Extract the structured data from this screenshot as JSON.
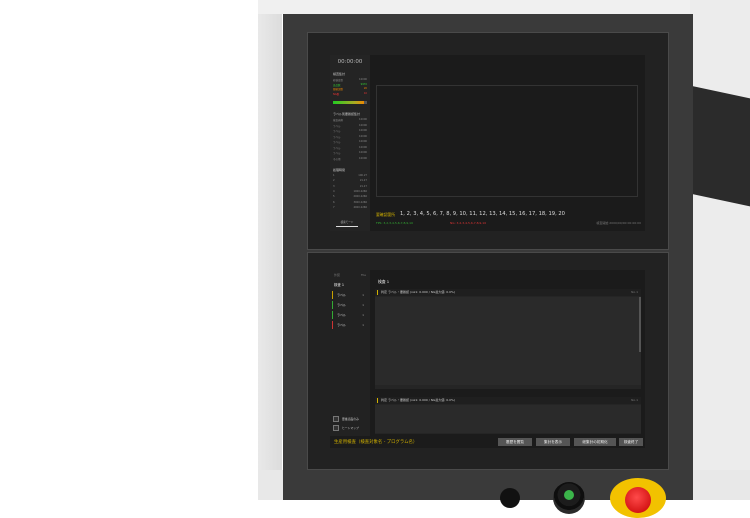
{
  "top_screen": {
    "timer": "00:00:00",
    "left_panel": {
      "section1_title": "検査集計",
      "section1_rows": [
        {
          "label": "総検査数",
          "value": "10000",
          "tone": "gray"
        },
        {
          "label": "良品数",
          "value": "9970",
          "tone": "green"
        },
        {
          "label": "要確認数",
          "value": "20",
          "tone": "orange"
        },
        {
          "label": "NG数",
          "value": "10",
          "tone": "red"
        }
      ],
      "progress": 0.9,
      "section2_title": "ラベル別要確認集計",
      "section2_rows": [
        {
          "label": "検査画像",
          "value": "10000"
        },
        {
          "label": "ラベル",
          "value": "10000"
        },
        {
          "label": "ラベル",
          "value": "10000"
        },
        {
          "label": "ラベル",
          "value": "10000"
        },
        {
          "label": "ラベル",
          "value": "10000"
        },
        {
          "label": "ラベル",
          "value": "10000"
        },
        {
          "label": "ラベル",
          "value": "10000"
        },
        {
          "label": "その他",
          "value": "10000"
        }
      ],
      "section3_title": "処理時間",
      "section3_rows": [
        {
          "label": "1",
          "value": "100.27"
        },
        {
          "label": "2",
          "value": "21.27"
        },
        {
          "label": "3",
          "value": "21.27"
        },
        {
          "label": "4",
          "value": "1000.2266"
        },
        {
          "label": "5",
          "value": "2000.2266"
        },
        {
          "label": "6",
          "value": "3000.2266"
        },
        {
          "label": "7",
          "value": "4000.2266"
        }
      ],
      "monitor_button": "検査モード"
    },
    "summary_label": "要確認箇所",
    "summary_numbers": "1, 2, 3, 4, 5, 6, 7, 8, 9, 10, 11, 12, 13, 14, 15, 16, 17, 18, 19, 20",
    "sub_green": "FPS: 3,2,3,4,5,6,7,8,9,10",
    "sub_red": "NG: 3,2,3,4,5,6,7,8,9,10",
    "timestamp": "検査開始 2000/00/00 00:00:00"
  },
  "bottom_screen": {
    "left_header_left": "外装",
    "left_header_right": "File",
    "item_title": "検査 1",
    "label_list": [
      {
        "label": "ラベル",
        "count": "1",
        "color": "#c8a000"
      },
      {
        "label": "ラベル",
        "count": "1",
        "color": "#33aa33"
      },
      {
        "label": "ラベル",
        "count": "1",
        "color": "#33aa33"
      },
      {
        "label": "ラベル",
        "count": "1",
        "color": "#cc3333"
      }
    ],
    "checkbox1": "要確認品のみ",
    "checkbox2": "ヒートマップ",
    "main_title": "検査 1",
    "panel1_header": "判定  ラベル・要確認 (x≥1: 0.000 / NG最大値: 0.0%)",
    "panel1_right": "No.1",
    "panel2_header": "判定  ラベル・要確認 (x≥1: 0.000 / NG最大値: 0.0%)",
    "panel2_right": "No.1",
    "status_text": "生産用検査（検査対象名 - プログラム名）",
    "buttons": [
      "履歴を閲覧",
      "集計を表示",
      "総集計の初期化",
      "検査終了"
    ]
  }
}
